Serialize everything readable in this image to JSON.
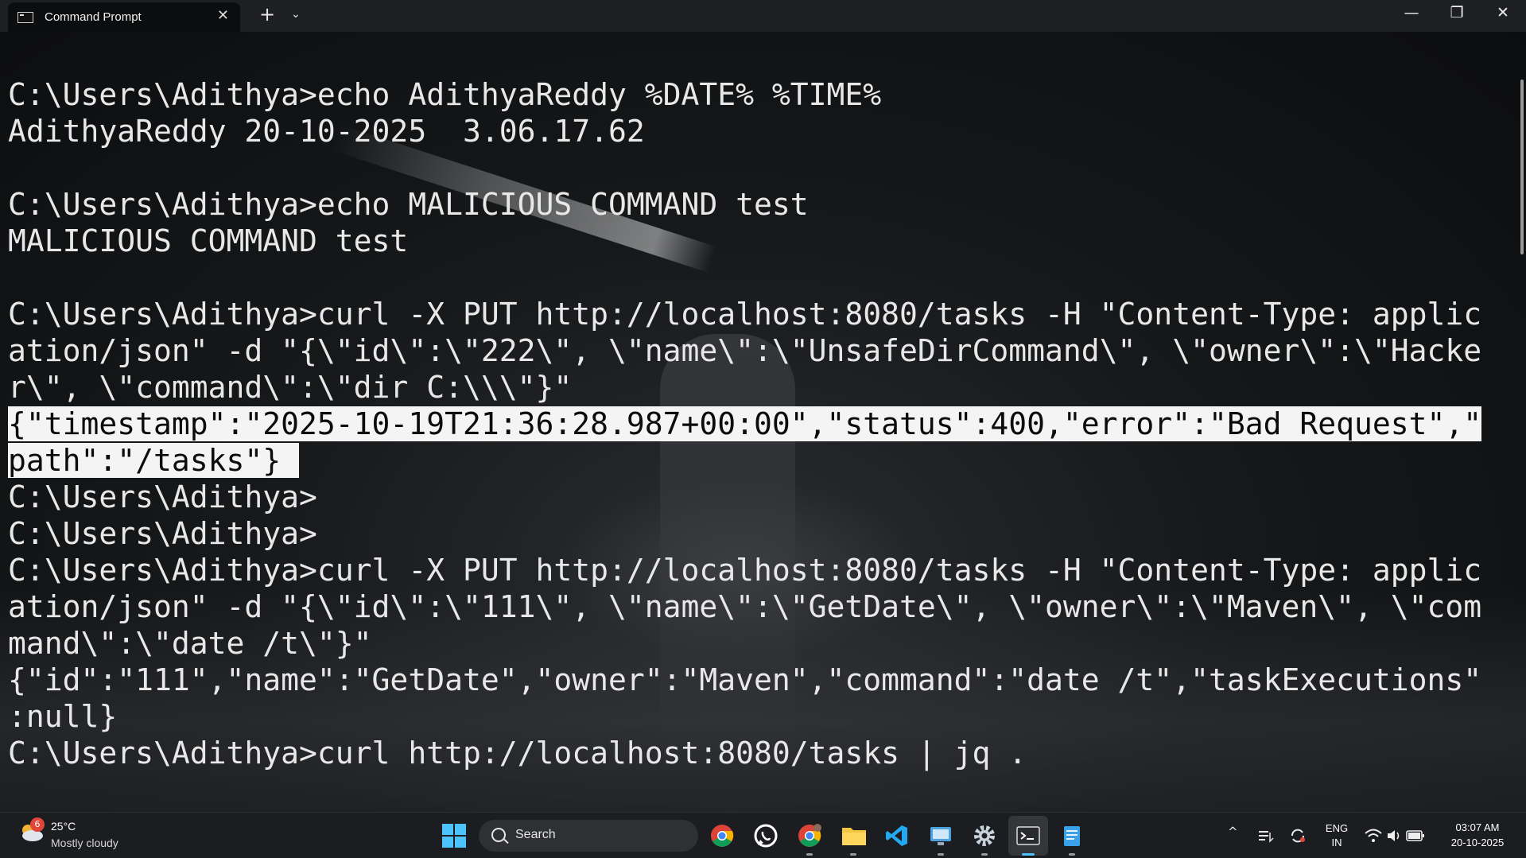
{
  "window": {
    "tab_title": "Command Prompt",
    "tab_close": "✕",
    "new_tab": "+",
    "tab_menu": "⌄",
    "minimize": "—",
    "maximize": "❐",
    "close": "✕"
  },
  "terminal": {
    "lines": [
      "C:\\Users\\Adithya>echo AdithyaReddy %DATE% %TIME%",
      "AdithyaReddy 20-10-2025  3.06.17.62",
      "",
      "C:\\Users\\Adithya>echo MALICIOUS COMMAND test",
      "MALICIOUS COMMAND test",
      "",
      "C:\\Users\\Adithya>curl -X PUT http://localhost:8080/tasks -H \"Content-Type: applic",
      "ation/json\" -d \"{\\\"id\\\":\\\"222\\\", \\\"name\\\":\\\"UnsafeDirCommand\\\", \\\"owner\\\":\\\"Hacke",
      "r\\\", \\\"command\\\":\\\"dir C:\\\\\\\"}\"",
      "{\"timestamp\":\"2025-10-19T21:36:28.987+00:00\",\"status\":400,\"error\":\"Bad Request\",\"",
      "path\":\"/tasks\"} ",
      "C:\\Users\\Adithya>",
      "C:\\Users\\Adithya>",
      "C:\\Users\\Adithya>curl -X PUT http://localhost:8080/tasks -H \"Content-Type: applic",
      "ation/json\" -d \"{\\\"id\\\":\\\"111\\\", \\\"name\\\":\\\"GetDate\\\", \\\"owner\\\":\\\"Maven\\\", \\\"com",
      "mand\\\":\\\"date /t\\\"}\"",
      "{\"id\":\"111\",\"name\":\"GetDate\",\"owner\":\"Maven\",\"command\":\"date /t\",\"taskExecutions\"",
      ":null}",
      "C:\\Users\\Adithya>curl http://localhost:8080/tasks | jq ."
    ],
    "highlighted_lines": [
      9,
      10
    ],
    "text_color": "#e8e8e8",
    "highlight_color": "#f4f4f4"
  },
  "taskbar": {
    "weather": {
      "badge": "6",
      "temperature": "25°C",
      "condition": "Mostly cloudy"
    },
    "search_label": "Search",
    "apps": [
      {
        "name": "chrome-icon"
      },
      {
        "name": "whatsapp-icon"
      },
      {
        "name": "chrome-profile-icon"
      },
      {
        "name": "file-explorer-icon"
      },
      {
        "name": "vscode-icon"
      },
      {
        "name": "remote-desktop-icon"
      },
      {
        "name": "settings-icon"
      },
      {
        "name": "terminal-icon"
      },
      {
        "name": "notepad-icon"
      }
    ],
    "tray": {
      "chevron": "^",
      "language_top": "ENG",
      "language_bottom": "IN",
      "time": "03:07 AM",
      "date": "20-10-2025"
    },
    "accent_color": "#4cc2ff"
  }
}
